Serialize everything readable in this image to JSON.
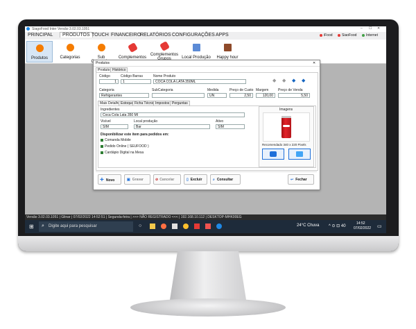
{
  "app": {
    "title": "SiagoFood Inter Versão 3.02.03.1051",
    "indicators": [
      "iFood",
      "SiaoFood",
      "Internet"
    ],
    "indicator_colors": [
      "#e53935",
      "#e53935",
      "#43a047"
    ]
  },
  "menu": [
    "PRINCIPAL",
    "PRODUTOS",
    "TOUCH",
    "FINANCEIRO",
    "RELATÓRIOS",
    "CONFIGURAÇÕES",
    "APPS"
  ],
  "ribbon": [
    "Produtos",
    "Categorias",
    "Sub Categorias",
    "Complementos",
    "Complementos Grupos",
    "Local Produção",
    "Happy hour"
  ],
  "dialog": {
    "title": "Produtos",
    "tabs": [
      "Produto",
      "Histórico"
    ],
    "fields": {
      "codigo_label": "Código",
      "codigo_value": "1",
      "codigo_barras_label": "Código Barras",
      "codigo_barras_value": "1",
      "nome_label": "Nome Produto",
      "nome_value": "COCA COLA LATA 350ML",
      "categoria_label": "Categoria",
      "categoria_value": "Refrigerantes",
      "subcategoria_label": "SubCategoria",
      "subcategoria_value": "",
      "medida_label": "Medida",
      "medida_value": "UN",
      "custo_label": "Preço de Custo",
      "custo_value": "2,50",
      "margem_label": "Margem",
      "margem_value": "120,00",
      "venda_label": "Preço de Venda",
      "venda_value": "5,50"
    },
    "subtabs": [
      "Mais Detalhes",
      "Estoque",
      "Ficha Técnica",
      "Impostos",
      "Perguntas"
    ],
    "ingredientes_label": "Ingredientes",
    "ingredientes_value": "Coca Cola Lata 350 Ml",
    "visivel_label": "Visível",
    "visivel_value": "SIM",
    "local_label": "Local produção",
    "local_value": "Bar",
    "ativo_label": "Ativo",
    "ativo_value": "SIM",
    "disponibilizar_label": "Disponibilizar este item para pedidos em:",
    "checks": [
      "Comanda Mobile",
      "Pedido Online ( SEUFOOD )",
      "Cardápio Digital na Mesa"
    ],
    "imagens_label": "Imagens",
    "image_note": "Recomendado 340 x 220 Pixels",
    "buttons": [
      "Novo",
      "Gravar",
      "Cancelar",
      "Excluir",
      "Consultar",
      "Fechar"
    ]
  },
  "status": "Versão 3.02.03.1051 | Glinar | 07/02/2022 14:52:51 | Segunda-feira | >>> NÃO REGISTRADO <<< | 192.168.10.112 | DESKTOP-MHK00EG",
  "taskbar": {
    "search": "Digite aqui para pesquisar",
    "weather": "24°C Chuva",
    "time": "14:52",
    "date": "07/02/2022"
  }
}
